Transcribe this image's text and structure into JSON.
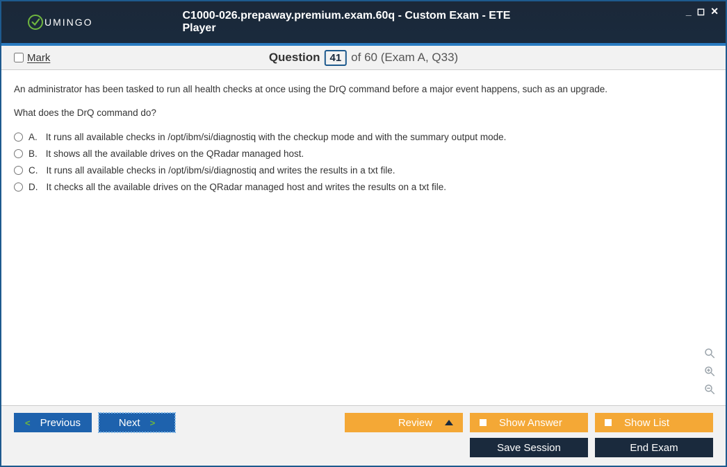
{
  "window": {
    "title": "C1000-026.prepaway.premium.exam.60q - Custom Exam - ETE Player",
    "logo_text": "UMINGO"
  },
  "subheader": {
    "mark_label": "Mark",
    "question_word": "Question",
    "current": "41",
    "total_suffix": "of 60 (Exam A, Q33)"
  },
  "question": {
    "intro": "An administrator has been tasked to run all health checks at once using the DrQ command before a major event happens, such as an upgrade.",
    "prompt": "What does the DrQ command do?"
  },
  "options": [
    {
      "letter": "A.",
      "text": "It runs all available checks in /opt/ibm/si/diagnostiq with the checkup mode and with the summary output mode."
    },
    {
      "letter": "B.",
      "text": "It shows all the available drives on the QRadar managed host."
    },
    {
      "letter": "C.",
      "text": "It runs all available checks in /opt/ibm/si/diagnostiq and writes the results in a txt file."
    },
    {
      "letter": "D.",
      "text": "It checks all the available drives on the QRadar managed host and writes the results on a txt file."
    }
  ],
  "footer": {
    "previous": "Previous",
    "next": "Next",
    "review": "Review",
    "show_answer": "Show Answer",
    "show_list": "Show List",
    "save_session": "Save Session",
    "end_exam": "End Exam"
  }
}
